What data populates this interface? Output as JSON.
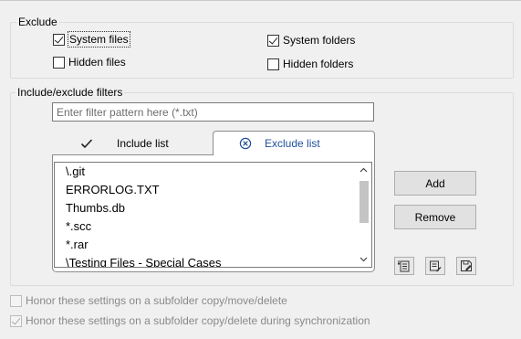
{
  "exclude": {
    "title": "Exclude",
    "system_files": {
      "label": "System files",
      "checked": true
    },
    "hidden_files": {
      "label": "Hidden files",
      "checked": false
    },
    "system_folders": {
      "label": "System folders",
      "checked": true
    },
    "hidden_folders": {
      "label": "Hidden folders",
      "checked": false
    }
  },
  "filters": {
    "title": "Include/exclude filters",
    "input_value": "",
    "input_placeholder": "Enter filter pattern here (*.txt)",
    "tabs": {
      "include_label": "Include list",
      "exclude_label": "Exclude list",
      "active": "exclude"
    },
    "exclude_items": [
      "\\.git",
      "ERRORLOG.TXT",
      "Thumbs.db",
      "*.scc",
      "*.rar",
      "\\Testing Files - Special Cases"
    ],
    "add_label": "Add",
    "remove_label": "Remove"
  },
  "options": {
    "subfolder_copy": {
      "label": "Honor these settings on a subfolder copy/move/delete",
      "checked": false
    },
    "subfolder_sync": {
      "label": "Honor these settings on a subfolder copy/delete during synchronization",
      "checked": true
    }
  },
  "colors": {
    "accent_tab_text": "#1f4f9a",
    "background": "#f0f0f0"
  }
}
